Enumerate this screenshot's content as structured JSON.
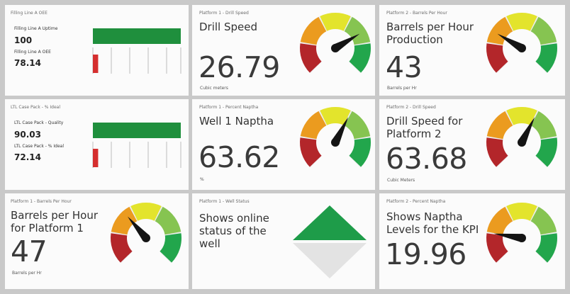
{
  "tiles": {
    "t1": {
      "caption": "Filling Line A OEE",
      "rows": [
        {
          "label": "Filling Line A Uptime",
          "value": "100",
          "fraction": 1.0
        },
        {
          "label": "Filling Line A OEE",
          "value": "78.14",
          "fraction": 0.06
        }
      ]
    },
    "t2": {
      "caption": "Platform 1 - Drill Speed",
      "title": "Drill Speed",
      "value": "26.79",
      "unit": "Cubic meters",
      "needle": 0.72
    },
    "t3": {
      "caption": "Platform 2 - Barrels Per Hour",
      "title": "Barrels per Hour Production",
      "value": "43",
      "unit": "Barrels per Hr",
      "needle": 0.28
    },
    "t4": {
      "caption": "LTL Case Pack - % Ideal",
      "rows": [
        {
          "label": "LTL Case Pack - Quality",
          "value": "90.03",
          "fraction": 1.0
        },
        {
          "label": "LTL Case Pack - % Ideal",
          "value": "72.14",
          "fraction": 0.06
        }
      ]
    },
    "t5": {
      "caption": "Platform 1 - Percent Naptha",
      "title": "Well 1 Naptha",
      "value": "63.62",
      "unit": "%",
      "needle": 0.6
    },
    "t6": {
      "caption": "Platform 2 - Drill Speed",
      "title": "Drill Speed for Platform 2",
      "value": "63.68",
      "unit": "Cubic Meters",
      "needle": 0.6
    },
    "t7": {
      "caption": "Platform 1 - Barrels Per Hour",
      "title": "Barrels per Hour for Platform 1",
      "value": "47",
      "unit": "Barrels per Hr",
      "needle": 0.35
    },
    "t8": {
      "caption": "Platform 1 - Well Status",
      "title": "Shows online status of the well"
    },
    "t9": {
      "caption": "Platform 2 - Percent Naptha",
      "title": "Shows Naptha Levels for the KPI",
      "value": "19.96",
      "unit": "",
      "needle": 0.2
    }
  },
  "colors": {
    "red": "#b3262a",
    "orange": "#eb9b1f",
    "yellow": "#e3e42c",
    "lightgreen": "#86c451",
    "green": "#22a64c",
    "bar_green": "#1f8f3d",
    "bar_red": "#d52f2f",
    "status_green": "#1e9c49",
    "status_grey": "#e3e3e3",
    "needle": "#141414"
  }
}
